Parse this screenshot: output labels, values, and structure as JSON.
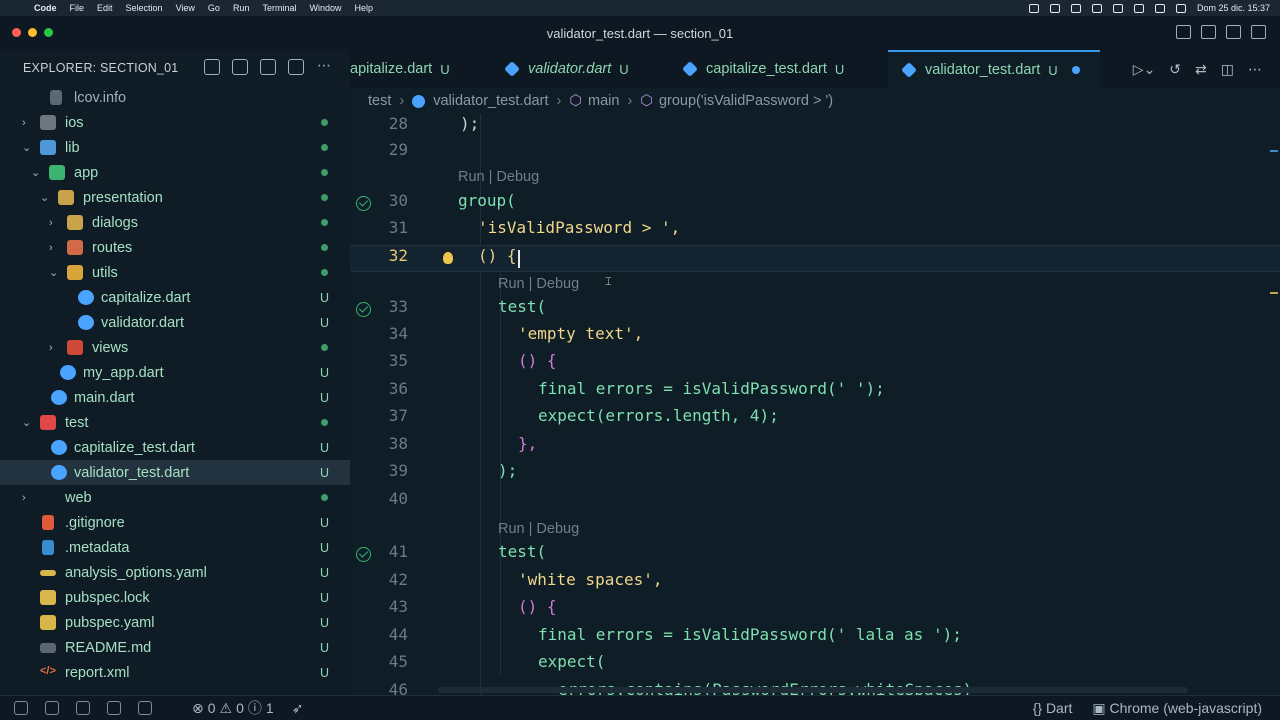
{
  "menubar": {
    "app": "Code",
    "items": [
      "File",
      "Edit",
      "Selection",
      "View",
      "Go",
      "Run",
      "Terminal",
      "Window",
      "Help"
    ],
    "clock": "Dom 25 dic.  15:37"
  },
  "window": {
    "title": "validator_test.dart — section_01"
  },
  "explorer": {
    "title": "EXPLORER: SECTION_01",
    "items": [
      {
        "label": "lcov.info",
        "status": ""
      },
      {
        "label": "ios",
        "status": "dot"
      },
      {
        "label": "lib",
        "status": "dot"
      },
      {
        "label": "app",
        "status": "dot"
      },
      {
        "label": "presentation",
        "status": "dot"
      },
      {
        "label": "dialogs",
        "status": "dot"
      },
      {
        "label": "routes",
        "status": "dot"
      },
      {
        "label": "utils",
        "status": "dot"
      },
      {
        "label": "capitalize.dart",
        "status": "U"
      },
      {
        "label": "validator.dart",
        "status": "U"
      },
      {
        "label": "views",
        "status": "dot"
      },
      {
        "label": "my_app.dart",
        "status": "U"
      },
      {
        "label": "main.dart",
        "status": "U"
      },
      {
        "label": "test",
        "status": "dot"
      },
      {
        "label": "capitalize_test.dart",
        "status": "U"
      },
      {
        "label": "validator_test.dart",
        "status": "U"
      },
      {
        "label": "web",
        "status": "dot"
      },
      {
        "label": ".gitignore",
        "status": "U"
      },
      {
        "label": ".metadata",
        "status": "U"
      },
      {
        "label": "analysis_options.yaml",
        "status": "U"
      },
      {
        "label": "pubspec.lock",
        "status": "U"
      },
      {
        "label": "pubspec.yaml",
        "status": "U"
      },
      {
        "label": "README.md",
        "status": "U"
      },
      {
        "label": "report.xml",
        "status": "U"
      }
    ]
  },
  "tabs": [
    {
      "label": "apitalize.dart",
      "status": "U"
    },
    {
      "label": "validator.dart",
      "status": "U"
    },
    {
      "label": "capitalize_test.dart",
      "status": "U"
    },
    {
      "label": "validator_test.dart",
      "status": "U"
    }
  ],
  "breadcrumb": [
    "test",
    "validator_test.dart",
    "main",
    "group('isValidPassword > ')"
  ],
  "codelens": "Run | Debug",
  "lines": {
    "28": ");",
    "29": "",
    "30": "group(",
    "31": "'isValidPassword > ',",
    "32": "() {",
    "33": "test(",
    "34": "'empty text',",
    "35": "() {",
    "36": "final errors = isValidPassword(' ');",
    "37": "expect(errors.length, 4);",
    "38": "},",
    "39": ");",
    "40": "",
    "41": "test(",
    "42": "'white spaces',",
    "43": "() {",
    "44": "final errors = isValidPassword(' lala as ');",
    "45": "expect(",
    "46": "errors.contains(PasswordErrors.whiteSpaces)"
  },
  "statusbar": {
    "errors": "0",
    "warnings": "0",
    "info": "1",
    "language": "Dart",
    "device": "Chrome (web-javascript)"
  }
}
